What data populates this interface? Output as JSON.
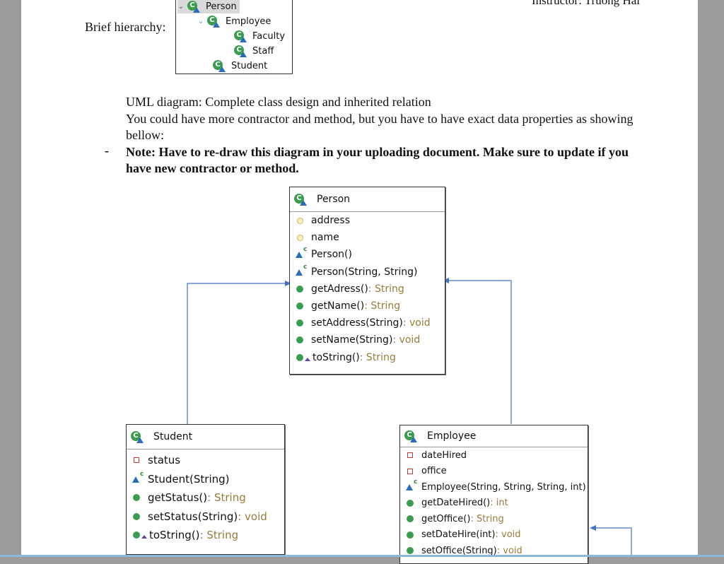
{
  "header": {
    "instructor_text": "Instructor: Truong Hai"
  },
  "brief_hierarchy": {
    "label": "Brief hierarchy:",
    "tree": [
      {
        "label": "Person",
        "level": 0,
        "expanded": true,
        "selected": true
      },
      {
        "label": "Employee",
        "level": 1,
        "expanded": true,
        "selected": false
      },
      {
        "label": "Faculty",
        "level": 2,
        "selected": false
      },
      {
        "label": "Staff",
        "level": 2,
        "selected": false
      },
      {
        "label": "Student",
        "level": 1,
        "selected": false
      }
    ]
  },
  "instructions": {
    "line1": "UML diagram: Complete class design and inherited relation",
    "line2": "You could have more contractor and method, but you have to have exact data properties as showing bellow:",
    "bullet": "-",
    "note": "Note: Have to re-draw this diagram in your uploading document. Make sure to update if you have new contractor or method."
  },
  "uml": {
    "person": {
      "name": "Person",
      "members": [
        {
          "kind": "package-field",
          "icon": "package-field-icon",
          "text": "address",
          "type": ""
        },
        {
          "kind": "package-field",
          "icon": "package-field-icon",
          "text": "name",
          "type": ""
        },
        {
          "kind": "constructor",
          "icon": "constructor-icon",
          "text": "Person()",
          "type": ""
        },
        {
          "kind": "constructor",
          "icon": "constructor-icon",
          "text": "Person(String, String)",
          "type": ""
        },
        {
          "kind": "public-method",
          "icon": "public-method-icon",
          "text": "getAdress()",
          "type": " : String"
        },
        {
          "kind": "public-method",
          "icon": "public-method-icon",
          "text": "getName()",
          "type": " : String"
        },
        {
          "kind": "public-method",
          "icon": "public-method-icon",
          "text": "setAddress(String)",
          "type": " : void"
        },
        {
          "kind": "public-method",
          "icon": "public-method-icon",
          "text": "setName(String)",
          "type": " : void"
        },
        {
          "kind": "override-method",
          "icon": "override-method-icon",
          "text": "toString()",
          "type": " : String"
        }
      ]
    },
    "student": {
      "name": "Student",
      "members": [
        {
          "kind": "private-field",
          "icon": "private-field-icon",
          "text": "status",
          "type": ""
        },
        {
          "kind": "constructor",
          "icon": "constructor-icon",
          "text": "Student(String)",
          "type": ""
        },
        {
          "kind": "public-method",
          "icon": "public-method-icon",
          "text": "getStatus()",
          "type": " : String"
        },
        {
          "kind": "public-method",
          "icon": "public-method-icon",
          "text": "setStatus(String)",
          "type": " : void"
        },
        {
          "kind": "override-method",
          "icon": "override-method-icon",
          "text": "toString()",
          "type": " : String"
        }
      ]
    },
    "employee": {
      "name": "Employee",
      "members": [
        {
          "kind": "private-field",
          "icon": "private-field-icon",
          "text": "dateHired",
          "type": ""
        },
        {
          "kind": "private-field",
          "icon": "private-field-icon",
          "text": "office",
          "type": ""
        },
        {
          "kind": "constructor",
          "icon": "constructor-icon",
          "text": "Employee(String, String, String, int)",
          "type": ""
        },
        {
          "kind": "public-method",
          "icon": "public-method-icon",
          "text": "getDateHired()",
          "type": " : int"
        },
        {
          "kind": "public-method",
          "icon": "public-method-icon",
          "text": "getOffice()",
          "type": " : String"
        },
        {
          "kind": "public-method",
          "icon": "public-method-icon",
          "text": "setDateHire(int)",
          "type": " : void"
        },
        {
          "kind": "public-method",
          "icon": "public-method-icon",
          "text": "setOffice(String)",
          "type": " : void"
        }
      ]
    }
  },
  "colors": {
    "page_background": "#ffffff",
    "margin_gray": "#9b9b9b",
    "arrow_blue": "#4472c4",
    "public_green": "#3b9b4f",
    "private_red": "#c83a3a",
    "return_type_tan": "#9a7a3a"
  }
}
